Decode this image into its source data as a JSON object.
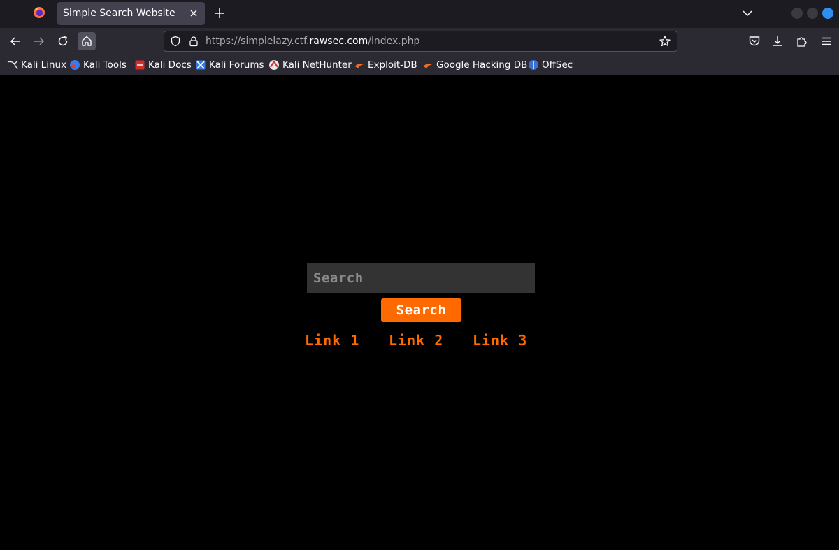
{
  "browser": {
    "tab": {
      "title": "Simple Search Website"
    },
    "url": {
      "prefix": "https://simplelazy.ctf.",
      "domain": "rawsec.com",
      "path": "/index.php"
    },
    "bookmarks": [
      {
        "label": "Kali Linux",
        "icon": "kali-dragon-icon"
      },
      {
        "label": "Kali Tools",
        "icon": "kali-tools-icon"
      },
      {
        "label": "Kali Docs",
        "icon": "kali-docs-icon"
      },
      {
        "label": "Kali Forums",
        "icon": "kali-forums-icon"
      },
      {
        "label": "Kali NetHunter",
        "icon": "kali-nethunter-icon"
      },
      {
        "label": "Exploit-DB",
        "icon": "exploit-db-icon"
      },
      {
        "label": "Google Hacking DB",
        "icon": "ghdb-icon"
      },
      {
        "label": "OffSec",
        "icon": "offsec-icon"
      }
    ]
  },
  "page": {
    "search": {
      "placeholder": "Search",
      "value": ""
    },
    "search_button": "Search",
    "links": [
      "Link 1",
      "Link 2",
      "Link 3"
    ]
  },
  "colors": {
    "accent": "#ff6a00",
    "page_background": "#000000",
    "input_background": "#333333",
    "chrome_dark": "#1c1b22",
    "chrome": "#2b2a33"
  }
}
